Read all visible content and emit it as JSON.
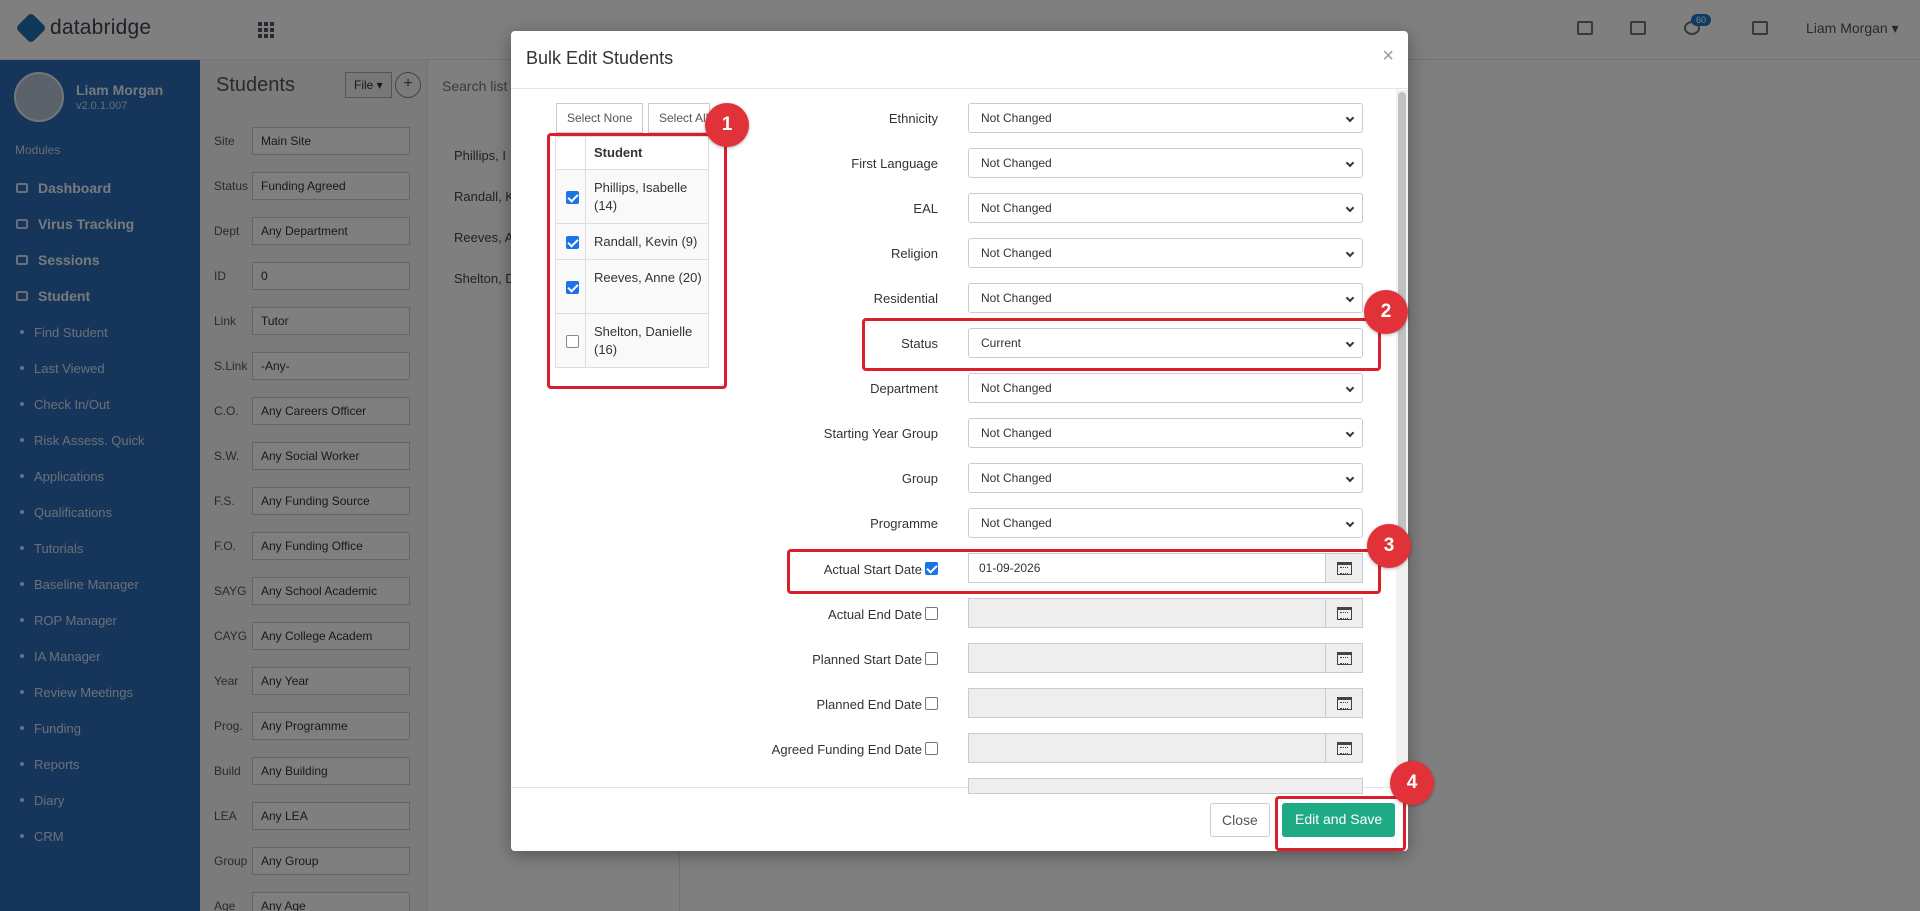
{
  "app": {
    "brand": "databridge",
    "user_menu": "Liam Morgan ▾",
    "notification_count": "60"
  },
  "sidebar": {
    "profile_name": "Liam Morgan",
    "profile_version": "v2.0.1.007",
    "modules_label": "Modules",
    "items": [
      {
        "label": "Dashboard",
        "bold": true
      },
      {
        "label": "Virus Tracking",
        "bold": true
      },
      {
        "label": "Sessions",
        "bold": true
      },
      {
        "label": "Student",
        "bold": true
      },
      {
        "label": "Find Student"
      },
      {
        "label": "Last Viewed"
      },
      {
        "label": "Check In/Out"
      },
      {
        "label": "Risk Assess. Quick"
      },
      {
        "label": "Applications"
      },
      {
        "label": "Qualifications"
      },
      {
        "label": "Tutorials"
      },
      {
        "label": "Baseline Manager"
      },
      {
        "label": "ROP Manager"
      },
      {
        "label": "IA Manager"
      },
      {
        "label": "Review Meetings"
      },
      {
        "label": "Funding"
      },
      {
        "label": "Reports"
      },
      {
        "label": "Diary"
      },
      {
        "label": "CRM"
      }
    ]
  },
  "filters": {
    "title": "Students",
    "file_btn": "File ▾",
    "add_btn": "+",
    "rows": [
      {
        "label": "Site",
        "value": "Main Site"
      },
      {
        "label": "Status",
        "value": "Funding Agreed"
      },
      {
        "label": "Dept",
        "value": "Any Department"
      },
      {
        "label": "ID",
        "value": "0"
      },
      {
        "label": "Link",
        "value": "Tutor"
      },
      {
        "label": "S.Link",
        "value": "-Any-"
      },
      {
        "label": "C.O.",
        "value": "Any Careers Officer"
      },
      {
        "label": "S.W.",
        "value": "Any Social Worker"
      },
      {
        "label": "F.S.",
        "value": "Any Funding Source"
      },
      {
        "label": "F.O.",
        "value": "Any Funding Office"
      },
      {
        "label": "SAYG",
        "value": "Any School Academic"
      },
      {
        "label": "CAYG",
        "value": "Any College Academ"
      },
      {
        "label": "Year",
        "value": "Any Year"
      },
      {
        "label": "Prog.",
        "value": "Any Programme"
      },
      {
        "label": "Build",
        "value": "Any Building"
      },
      {
        "label": "LEA",
        "value": "Any LEA"
      },
      {
        "label": "Group",
        "value": "Any Group"
      },
      {
        "label": "Age",
        "value": "Any Age"
      }
    ]
  },
  "list": {
    "search_placeholder": "Search list",
    "items": [
      "Phillips, I",
      "Randall, K",
      "Reeves, A",
      "Shelton, D"
    ]
  },
  "modal": {
    "title": "Bulk Edit Students",
    "close_symbol": "×",
    "select_none": "Select None",
    "select_all": "Select All",
    "student_header": "Student",
    "students": [
      {
        "name": "Phillips, Isabelle (14)",
        "checked": true
      },
      {
        "name": "Randall, Kevin (9)",
        "checked": true
      },
      {
        "name": "Reeves, Anne (20)",
        "checked": true
      },
      {
        "name": "Shelton, Danielle (16)",
        "checked": false
      }
    ],
    "fields": [
      {
        "label": "Ethnicity",
        "value": "Not Changed"
      },
      {
        "label": "First Language",
        "value": "Not Changed"
      },
      {
        "label": "EAL",
        "value": "Not Changed"
      },
      {
        "label": "Religion",
        "value": "Not Changed"
      },
      {
        "label": "Residential",
        "value": "Not Changed"
      },
      {
        "label": "Status",
        "value": "Current"
      },
      {
        "label": "Department",
        "value": "Not Changed"
      },
      {
        "label": "Starting Year Group",
        "value": "Not Changed"
      },
      {
        "label": "Group",
        "value": "Not Changed"
      },
      {
        "label": "Programme",
        "value": "Not Changed"
      }
    ],
    "dates": [
      {
        "label": "Actual Start Date",
        "checked": true,
        "value": "01-09-2026"
      },
      {
        "label": "Actual End Date",
        "checked": false,
        "value": ""
      },
      {
        "label": "Planned Start Date",
        "checked": false,
        "value": ""
      },
      {
        "label": "Planned End Date",
        "checked": false,
        "value": ""
      },
      {
        "label": "Agreed Funding End Date",
        "checked": false,
        "value": ""
      }
    ],
    "close_button": "Close",
    "save_button": "Edit and Save"
  },
  "annotations": [
    "1",
    "2",
    "3",
    "4"
  ]
}
